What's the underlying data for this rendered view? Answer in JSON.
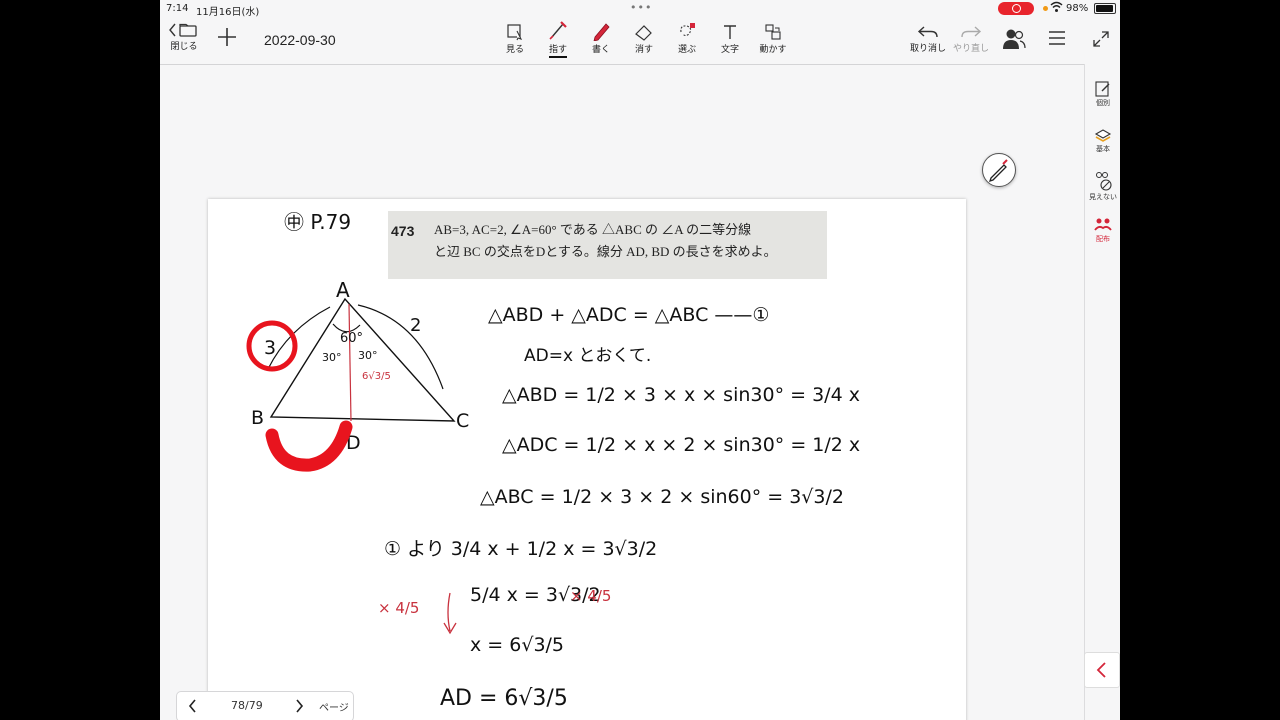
{
  "status": {
    "time": "7:14",
    "date": "11月16日(水)",
    "battery": "98%"
  },
  "toolbar": {
    "close_label": "閉じる",
    "title": "2022-09-30",
    "tools": {
      "view": "見る",
      "point": "指す",
      "write": "書く",
      "erase": "消す",
      "select": "選ぶ",
      "text": "文字",
      "move": "動かす"
    },
    "undo": "取り消し",
    "redo": "やり直し"
  },
  "sidebar": {
    "individual": "個別",
    "basic": "基本",
    "hidden": "見えない",
    "distribute": "配布"
  },
  "problem": {
    "number": "473",
    "line1": "AB=3, AC=2, ∠A=60° である △ABC の ∠A の二等分線",
    "line2": "と辺 BC の交点をDとする。線分 AD, BD の長さを求めよ。"
  },
  "handwriting": {
    "ref": "㊥ P.79",
    "vertex_a": "A",
    "vertex_b": "B",
    "vertex_c": "C",
    "vertex_d": "D",
    "side_ab": "3",
    "side_ac": "2",
    "angle_a": "60°",
    "half_angle_left": "30°",
    "half_angle_right": "30°",
    "ad_value": "6√3/5",
    "eq1": "△ABD + △ADC = △ABC ——①",
    "eq2": "AD=x とおくて.",
    "eq3": "△ABD = 1/2 × 3 × x × sin30° = 3/4 x",
    "eq4": "△ADC = 1/2 × x × 2 × sin30° = 1/2 x",
    "eq5": "△ABC = 1/2 × 3 × 2 × sin60° = 3√3/2",
    "eq6": "① より 3/4 x + 1/2 x = 3√3/2",
    "eq7": "5/4 x = 3√3/2",
    "eq8": "x = 6√3/5",
    "eq9": "AD = 6√3/5",
    "mult_note": "× 4/5"
  },
  "pagenav": {
    "counter": "78/79",
    "label": "ページ"
  },
  "colors": {
    "accent": "#d4263a",
    "ink": "#111111",
    "red_ink": "#c8323e",
    "highlighter": "#e8141e",
    "problem_bg": "#e4e4e1"
  }
}
